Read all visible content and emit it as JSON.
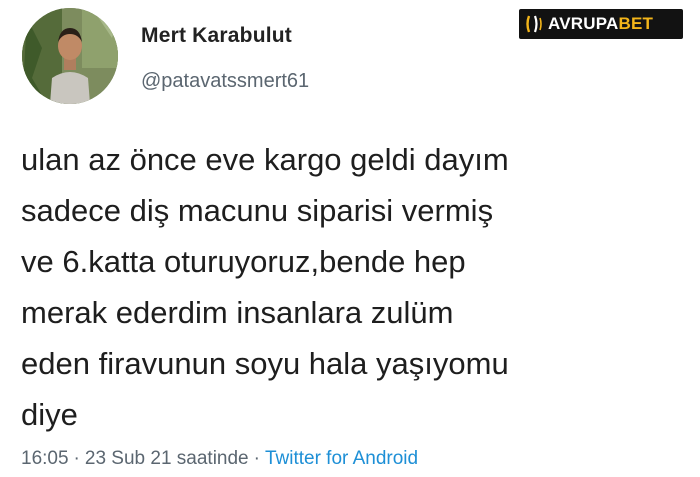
{
  "user": {
    "display_name": "Mert Karabulut",
    "handle": "@patavatssmert61"
  },
  "brand": {
    "part1": "AVRUPA",
    "part2": "BET",
    "accent_color": "#f3b51a",
    "background": "#121212"
  },
  "tweet": {
    "lines": [
      "ulan az önce eve kargo geldi dayım",
      "sadece diş macunu siparisi vermiş",
      "ve 6.katta oturuyoruz,bende hep",
      "merak ederdim insanlara zulüm",
      "eden firavunun soyu hala yaşıyomu",
      "diye"
    ]
  },
  "meta": {
    "time": "16:05",
    "separator": "·",
    "date": "23 Sub 21 saatinde",
    "source": "Twitter for Android",
    "source_color": "#1d8fd6"
  }
}
